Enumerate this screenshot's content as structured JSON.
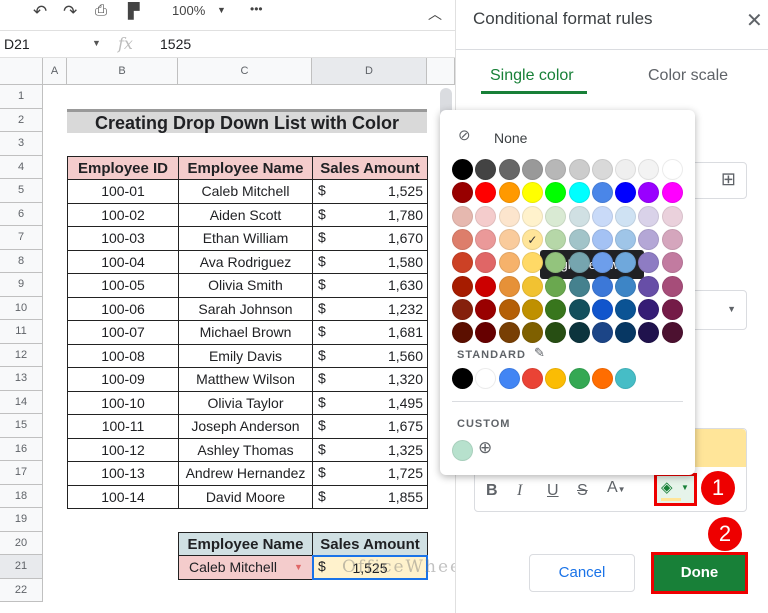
{
  "toolbar": {
    "zoom": "100%",
    "undo_icon": "undo-icon",
    "redo_icon": "redo-icon",
    "print_icon": "print-icon",
    "paint_format_icon": "paint-format-icon",
    "more": "•••"
  },
  "formula_bar": {
    "cell_ref": "D21",
    "fx": "fx",
    "value": "1525"
  },
  "columns": [
    "A",
    "B",
    "C",
    "D"
  ],
  "rows": [
    "1",
    "2",
    "3",
    "4",
    "5",
    "6",
    "7",
    "8",
    "9",
    "10",
    "11",
    "12",
    "13",
    "14",
    "15",
    "16",
    "17",
    "18",
    "19",
    "20",
    "21",
    "22"
  ],
  "sheet": {
    "title": "Creating Drop Down List with Color",
    "headers": [
      "Employee ID",
      "Employee Name",
      "Sales Amount"
    ],
    "data": [
      [
        "100-01",
        "Caleb Mitchell",
        "1,525"
      ],
      [
        "100-02",
        "Aiden Scott",
        "1,780"
      ],
      [
        "100-03",
        "Ethan William",
        "1,670"
      ],
      [
        "100-04",
        "Ava Rodriguez",
        "1,580"
      ],
      [
        "100-05",
        "Olivia Smith",
        "1,630"
      ],
      [
        "100-06",
        "Sarah Johnson",
        "1,232"
      ],
      [
        "100-07",
        "Michael Brown",
        "1,681"
      ],
      [
        "100-08",
        "Emily Davis",
        "1,560"
      ],
      [
        "100-09",
        "Matthew Wilson",
        "1,320"
      ],
      [
        "100-10",
        "Olivia Taylor",
        "1,495"
      ],
      [
        "100-11",
        "Joseph Anderson",
        "1,675"
      ],
      [
        "100-12",
        "Ashley Thomas",
        "1,325"
      ],
      [
        "100-13",
        "Andrew Hernandez",
        "1,725"
      ],
      [
        "100-14",
        "David Moore",
        "1,855"
      ]
    ],
    "currency": "$",
    "lookup_headers": [
      "Employee Name",
      "Sales Amount"
    ],
    "lookup_name": "Caleb Mitchell",
    "lookup_amount": "1,525",
    "watermark": "OfficeWheel"
  },
  "panel": {
    "title": "Conditional format rules",
    "tabs": [
      "Single color",
      "Color scale"
    ],
    "active_tab": 0,
    "cancel": "Cancel",
    "done": "Done",
    "preview_color": "#ffe599"
  },
  "picker": {
    "none_label": "None",
    "standard_label": "STANDARD",
    "custom_label": "CUSTOM",
    "tooltip": "light yellow 2",
    "selected": [
      3,
      3
    ],
    "palette": [
      [
        "#000000",
        "#434343",
        "#666666",
        "#999999",
        "#b7b7b7",
        "#cccccc",
        "#d9d9d9",
        "#efefef",
        "#f3f3f3",
        "#ffffff"
      ],
      [
        "#980000",
        "#ff0000",
        "#ff9900",
        "#ffff00",
        "#00ff00",
        "#00ffff",
        "#4a86e8",
        "#0000ff",
        "#9900ff",
        "#ff00ff"
      ],
      [
        "#e6b8af",
        "#f4cccc",
        "#fce5cd",
        "#fff2cc",
        "#d9ead3",
        "#d0e0e3",
        "#c9daf8",
        "#cfe2f3",
        "#d9d2e9",
        "#ead1dc"
      ],
      [
        "#dd7e6b",
        "#ea9999",
        "#f9cb9c",
        "#ffe599",
        "#b6d7a8",
        "#a2c4c9",
        "#a4c2f4",
        "#9fc5e8",
        "#b4a7d6",
        "#d5a6bd"
      ],
      [
        "#cc4125",
        "#e06666",
        "#f6b26b",
        "#ffd966",
        "#93c47d",
        "#76a5af",
        "#6d9eeb",
        "#6fa8dc",
        "#8e7cc3",
        "#c27ba0"
      ],
      [
        "#a61c00",
        "#cc0000",
        "#e69138",
        "#f1c232",
        "#6aa84f",
        "#45818e",
        "#3c78d8",
        "#3d85c6",
        "#674ea7",
        "#a64d79"
      ],
      [
        "#85200c",
        "#990000",
        "#b45f06",
        "#bf9000",
        "#38761d",
        "#134f5c",
        "#1155cc",
        "#0b5394",
        "#351c75",
        "#741b47"
      ],
      [
        "#5b0f00",
        "#660000",
        "#783f04",
        "#7f6000",
        "#274e13",
        "#0c343d",
        "#1c4587",
        "#073763",
        "#20124d",
        "#4c1130"
      ]
    ],
    "standard": [
      "#000000",
      "#ffffff",
      "#4285f4",
      "#ea4335",
      "#fbbc04",
      "#34a853",
      "#ff6d01",
      "#46bdc6"
    ],
    "custom": [
      "#b7e1cd"
    ]
  },
  "annotations": [
    "1",
    "2"
  ]
}
